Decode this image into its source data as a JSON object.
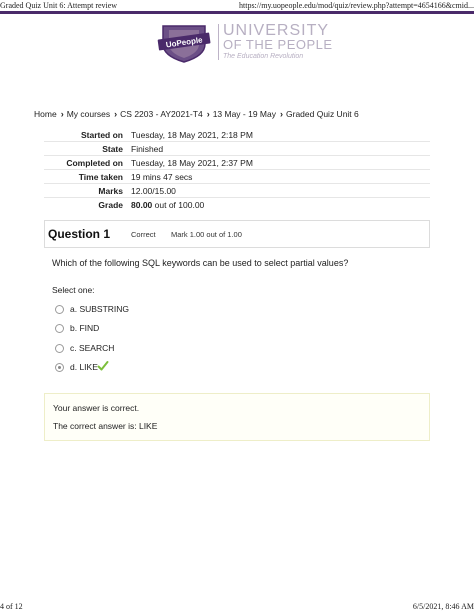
{
  "print_header": {
    "title": "Graded Quiz Unit 6: Attempt review",
    "url": "https://my.uopeople.edu/mod/quiz/review.php?attempt=4654166&cmid..."
  },
  "print_footer": {
    "page": "4 of 12",
    "datetime": "6/5/2021, 8:46 AM"
  },
  "logo": {
    "shield_text": "UoPeople",
    "line1": "UNIVERSITY",
    "line2": "OF THE PEOPLE",
    "tagline": "The Education Revolution"
  },
  "breadcrumb": [
    "Home",
    "My courses",
    "CS 2203 - AY2021-T4",
    "13 May - 19 May",
    "Graded Quiz Unit 6"
  ],
  "summary": [
    {
      "label": "Started on",
      "value": "Tuesday, 18 May 2021, 2:18 PM"
    },
    {
      "label": "State",
      "value": "Finished"
    },
    {
      "label": "Completed on",
      "value": "Tuesday, 18 May 2021, 2:37 PM"
    },
    {
      "label": "Time taken",
      "value": "19 mins 47 secs"
    },
    {
      "label": "Marks",
      "value": "12.00/15.00"
    },
    {
      "label": "Grade",
      "value_bold": "80.00",
      "value_rest": " out of 100.00"
    }
  ],
  "question": {
    "title": "Question 1",
    "state": "Correct",
    "mark": "Mark 1.00 out of 1.00",
    "text": "Which of the following SQL keywords can be used to select partial values?",
    "select_label": "Select one:",
    "options": [
      {
        "label": "a. SUBSTRING",
        "checked": false
      },
      {
        "label": "b. FIND",
        "checked": false
      },
      {
        "label": "c. SEARCH",
        "checked": false
      },
      {
        "label": "d. LIKE",
        "checked": true
      }
    ],
    "correct_icon": "check-icon",
    "feedback": {
      "result": "Your answer is correct.",
      "correct_answer": "The correct answer is: LIKE"
    }
  },
  "colors": {
    "brand_purple": "#4a2a6a",
    "logo_grey": "#b7afc2",
    "tick_green": "#7cbf3a"
  }
}
